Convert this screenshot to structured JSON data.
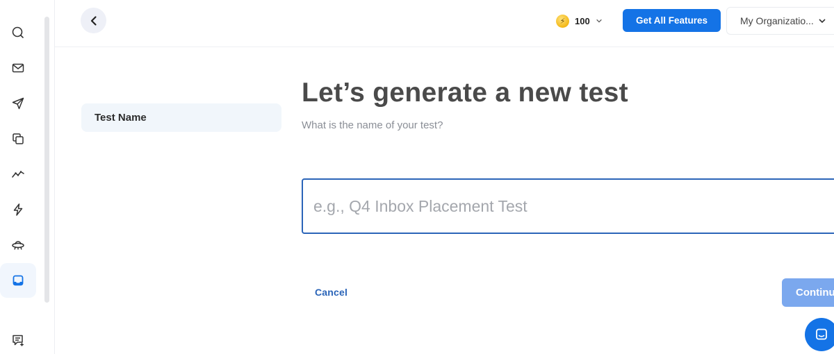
{
  "sidebar": {
    "items": [
      {
        "icon": "search-icon",
        "label": ""
      },
      {
        "icon": "mail-icon",
        "label": ""
      },
      {
        "icon": "send-icon",
        "label": ""
      },
      {
        "icon": "copy-icon",
        "label": ""
      },
      {
        "icon": "analytics-icon",
        "label": ""
      },
      {
        "icon": "lightning-icon",
        "label": ""
      },
      {
        "icon": "ufo-icon",
        "label": ""
      },
      {
        "icon": "inbox-icon",
        "label": "",
        "active": true
      },
      {
        "icon": "feedback-icon",
        "label": ""
      }
    ],
    "accent": "#1473e6"
  },
  "header": {
    "credits": "100",
    "credits_icon": "coin-icon",
    "features_button": "Get All Features",
    "organization": "My Organizatio..."
  },
  "steps": [
    {
      "label": "Test Name",
      "active": true
    }
  ],
  "main": {
    "title": "Let’s generate a new test",
    "subtitle": "What is the name of your test?",
    "input_placeholder": "e.g., Q4 Inbox Placement Test",
    "input_value": "",
    "cancel_label": "Cancel",
    "continue_label": "Continu"
  },
  "colors": {
    "primary": "#1473e6",
    "input_border": "#2a64b8",
    "continue_disabled": "#7ba8ee"
  }
}
